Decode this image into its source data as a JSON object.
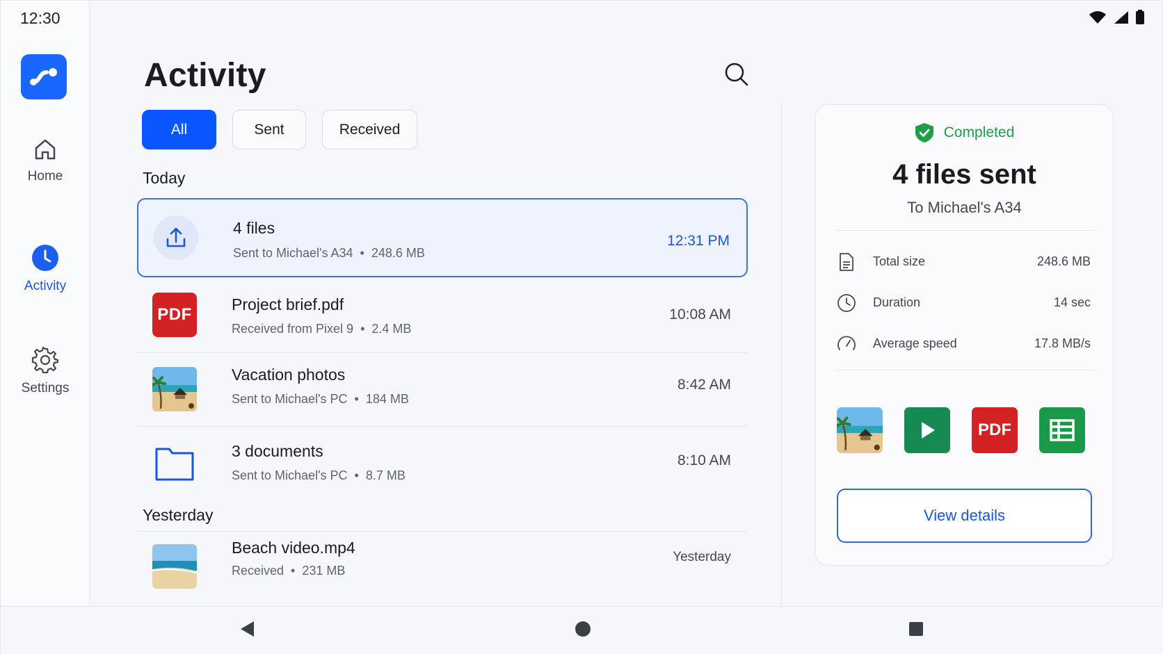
{
  "status_bar": {
    "time": "12:30"
  },
  "rail": {
    "items": [
      {
        "label": "Home"
      },
      {
        "label": "Activity"
      },
      {
        "label": "Settings"
      }
    ]
  },
  "main": {
    "title": "Activity",
    "filters": [
      {
        "label": "All",
        "selected": true
      },
      {
        "label": "Sent",
        "selected": false
      },
      {
        "label": "Received",
        "selected": false
      }
    ],
    "sections": [
      {
        "label": "Today",
        "items": [
          {
            "title": "4 files",
            "direction": "Sent to Michael's A34",
            "size": "248.6 MB",
            "time": "12:31 PM",
            "icon": "upload-icon",
            "selected": true
          },
          {
            "title": "Project brief.pdf",
            "direction": "Received from Pixel 9",
            "size": "2.4 MB",
            "time": "10:08 AM",
            "icon": "pdf-icon"
          },
          {
            "title": "Vacation photos",
            "direction": "Sent to Michael's PC",
            "size": "184 MB",
            "time": "8:42 AM",
            "icon": "beach-photo-thumbnail"
          },
          {
            "title": "3 documents",
            "direction": "Sent to Michael's PC",
            "size": "8.7 MB",
            "time": "8:10 AM",
            "icon": "folder-icon"
          }
        ]
      },
      {
        "label": "Yesterday",
        "items": [
          {
            "title": "Beach video.mp4",
            "direction": "Received",
            "size": "231 MB",
            "time": "Yesterday",
            "icon": "beach-video-thumbnail"
          }
        ]
      }
    ],
    "dot": "•",
    "pdf_badge": "PDF"
  },
  "details": {
    "status": "Completed",
    "title": "4 files sent",
    "subtitle": "To Michael's A34",
    "stats": [
      {
        "label": "Total size",
        "value": "248.6 MB",
        "icon": "document-icon"
      },
      {
        "label": "Duration",
        "value": "14 sec",
        "icon": "clock-icon"
      },
      {
        "label": "Average speed",
        "value": "17.8 MB/s",
        "icon": "speedometer-icon"
      }
    ],
    "files": [
      "beach-photo-thumbnail",
      "video-play-icon",
      "pdf-icon",
      "spreadsheet-icon"
    ],
    "view_button": "View details"
  },
  "colors": {
    "accent": "#0b57ff",
    "success": "#1e9e4a",
    "pdf_red": "#d42124",
    "video_green": "#168a52",
    "sheet_green": "#1a9a48"
  }
}
